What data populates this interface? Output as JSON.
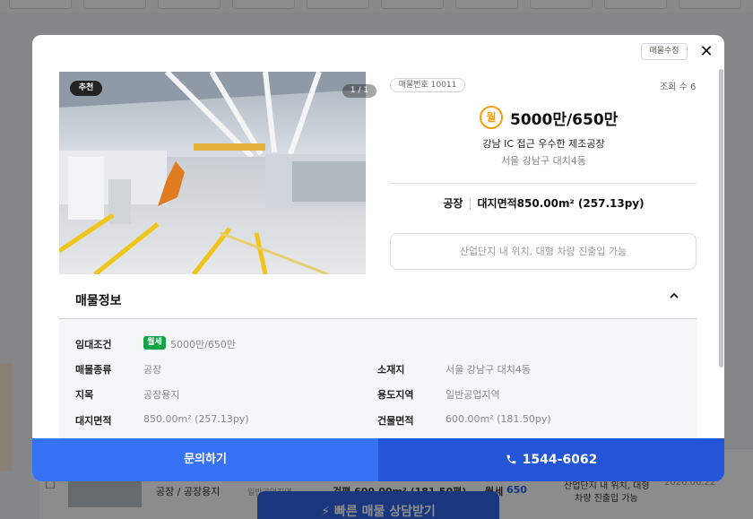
{
  "background": {
    "list_row": {
      "type_label": "공장 / 공장용지",
      "zone": "일반공업지역",
      "area": "건평 600.00m² (181.50평)",
      "price_prefix": "월세",
      "price_value": "650",
      "desc_line1": "산업단지 내 위치, 대형",
      "desc_line2": "차량 진출입 가능",
      "date": "2026.06.22"
    },
    "cta_label": "빠른 매물 상담받기"
  },
  "modal": {
    "edit_label": "매물수정",
    "close_glyph": "✕",
    "photo": {
      "recommend_tag": "추천",
      "counter": "1 / 1"
    },
    "listing_id": "매물번호 10011",
    "views": "조회 수 6",
    "month_badge": "월",
    "price": "5000만/650만",
    "title": "강남 IC 접근 우수한 제조공장",
    "address": "서울 강남구 대치4동",
    "spec_type": "공장",
    "spec_land": "대지면적850.00m² (257.13py)",
    "note": "산업단지 내 위치, 대형 차량 진출입 가능",
    "section_title": "매물정보",
    "chevron_glyph": "⌃",
    "info": {
      "rent_label": "임대조건",
      "rent_type": "월세",
      "rent_value": "5000만/650만",
      "kind_label": "매물종류",
      "kind_value": "공장",
      "location_label": "소재지",
      "location_value": "서울 강남구 대치4동",
      "land_cat_label": "지목",
      "land_cat_value": "공장용지",
      "zoning_label": "용도지역",
      "zoning_value": "일반공업지역",
      "land_area_label": "대지면적",
      "land_area_value": "850.00m² (257.13py)",
      "bldg_area_label": "건물면적",
      "bldg_area_value": "600.00m² (181.50py)"
    },
    "inquiry_label": "문의하기",
    "phone": "1544-6062"
  },
  "colors": {
    "primary": "#3572f5",
    "primary_dark": "#2455d6",
    "accent_orange": "#f59e0b",
    "rent_green": "#16a34a"
  }
}
